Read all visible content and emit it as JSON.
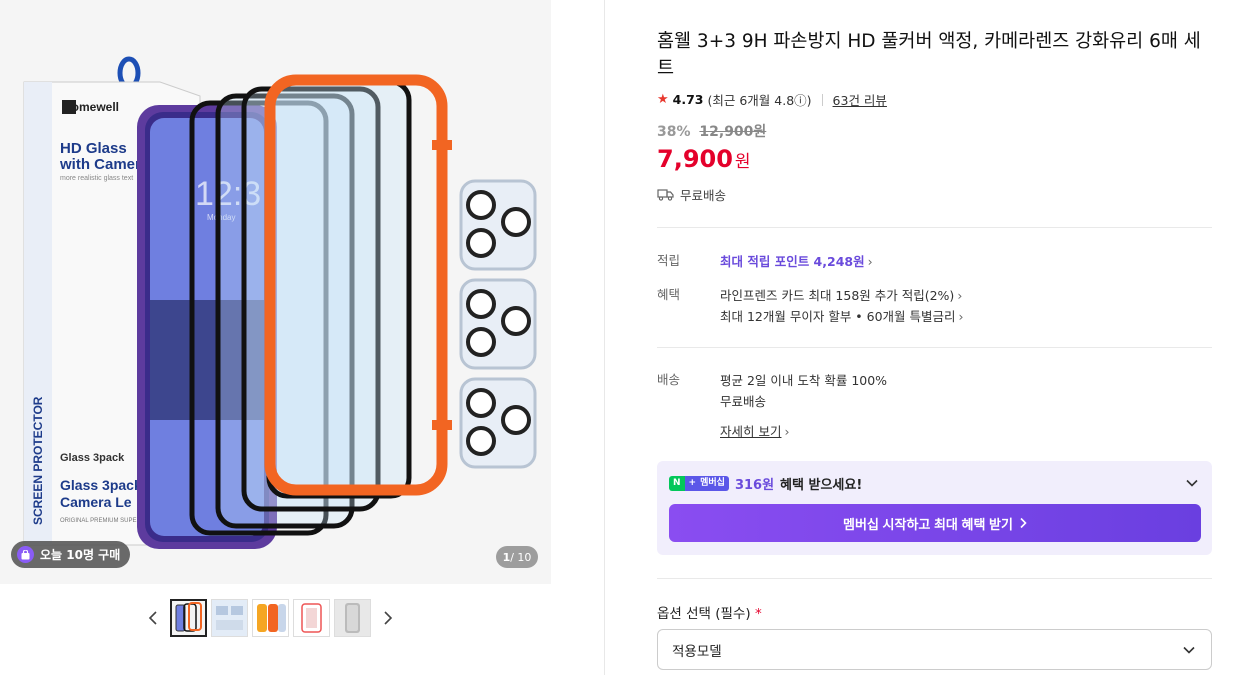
{
  "product": {
    "title": "홈웰 3+3 9H 파손방지 HD 풀커버 액정, 카메라렌즈 강화유리 6매 세트",
    "rating": "4.73",
    "rating_recent": "(최근 6개월 4.8ⓘ)",
    "review_link": "63건 리뷰",
    "discount_rate": "38%",
    "original_price": "12,900원",
    "price": "7,900",
    "price_unit": "원",
    "free_shipping_tag": "무료배송"
  },
  "gallery": {
    "today_purchase": "오늘 10명 구매",
    "page_current": "1",
    "page_total": " / 10",
    "box_brand": "Homewell",
    "box_line1": "HD Glass",
    "box_line2": "with Camera",
    "box_side": "SCREEN PROTECTOR",
    "box_glass": "Glass 3pack",
    "box_bottom1": "Glass 3pack",
    "box_bottom2": "Camera Le",
    "box_small": "ORIGINAL PREMIUM SUPE",
    "box_tagline": "more realistic glass text",
    "phone_time": "12:3",
    "phone_day": "Monday"
  },
  "benefits": {
    "points_label": "적립",
    "points_text": "최대 적립 포인트 4,248원",
    "benefit_label": "혜택",
    "benefit_line1": "라인프렌즈 카드 최대 158원 추가 적립(2%)",
    "benefit_line2": "최대 12개월 무이자 할부 • 60개월 특별금리"
  },
  "delivery": {
    "label": "배송",
    "line1": "평균 2일 이내 도착 확률 100%",
    "line2": "무료배송",
    "detail_link": "자세히 보기"
  },
  "membership": {
    "n_badge": "N",
    "plus_badge": "+",
    "m_badge": "멤버십",
    "amount": "316원",
    "text": "혜택 받으세요!",
    "button": "멤버십 시작하고 최대 혜택 받기"
  },
  "option": {
    "label": "옵션 선택 (필수)",
    "required_mark": "*",
    "selected": "적용모델"
  },
  "colors": {
    "price_red": "#e4012b",
    "membership_purple": "#6a4bdc",
    "frame_orange": "#f26522"
  }
}
